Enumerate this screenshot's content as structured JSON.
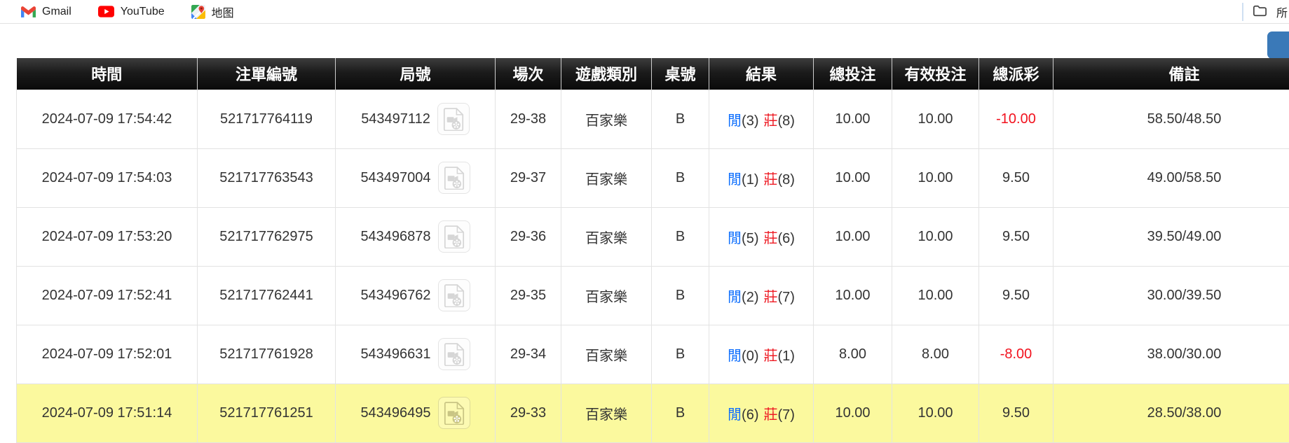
{
  "bookmarks_bar": {
    "items": [
      {
        "label": "Gmail",
        "icon": "gmail-icon"
      },
      {
        "label": "YouTube",
        "icon": "youtube-icon"
      },
      {
        "label": "地图",
        "icon": "maps-icon"
      }
    ],
    "all_bookmarks_label": "所"
  },
  "side_panel_button": {
    "color": "#3a79b8"
  },
  "table": {
    "columns": [
      "時間",
      "注單編號",
      "局號",
      "場次",
      "遊戲類別",
      "桌號",
      "結果",
      "總投注",
      "有效投注",
      "總派彩",
      "備註"
    ],
    "rows": [
      {
        "time": "2024-07-09 17:54:42",
        "bet_no": "521717764119",
        "round_no": "543497112",
        "session": "29-38",
        "game_type": "百家樂",
        "table_no": "B",
        "result": {
          "player_label": "閒",
          "player_score": "(3)",
          "banker_label": "莊",
          "banker_score": "(8)"
        },
        "total_bet": "10.00",
        "valid_bet": "10.00",
        "payout": "-10.00",
        "remark": "58.50/48.50",
        "highlighted": false
      },
      {
        "time": "2024-07-09 17:54:03",
        "bet_no": "521717763543",
        "round_no": "543497004",
        "session": "29-37",
        "game_type": "百家樂",
        "table_no": "B",
        "result": {
          "player_label": "閒",
          "player_score": "(1)",
          "banker_label": "莊",
          "banker_score": "(8)"
        },
        "total_bet": "10.00",
        "valid_bet": "10.00",
        "payout": "9.50",
        "remark": "49.00/58.50",
        "highlighted": false
      },
      {
        "time": "2024-07-09 17:53:20",
        "bet_no": "521717762975",
        "round_no": "543496878",
        "session": "29-36",
        "game_type": "百家樂",
        "table_no": "B",
        "result": {
          "player_label": "閒",
          "player_score": "(5)",
          "banker_label": "莊",
          "banker_score": "(6)"
        },
        "total_bet": "10.00",
        "valid_bet": "10.00",
        "payout": "9.50",
        "remark": "39.50/49.00",
        "highlighted": false
      },
      {
        "time": "2024-07-09 17:52:41",
        "bet_no": "521717762441",
        "round_no": "543496762",
        "session": "29-35",
        "game_type": "百家樂",
        "table_no": "B",
        "result": {
          "player_label": "閒",
          "player_score": "(2)",
          "banker_label": "莊",
          "banker_score": "(7)"
        },
        "total_bet": "10.00",
        "valid_bet": "10.00",
        "payout": "9.50",
        "remark": "30.00/39.50",
        "highlighted": false
      },
      {
        "time": "2024-07-09 17:52:01",
        "bet_no": "521717761928",
        "round_no": "543496631",
        "session": "29-34",
        "game_type": "百家樂",
        "table_no": "B",
        "result": {
          "player_label": "閒",
          "player_score": "(0)",
          "banker_label": "莊",
          "banker_score": "(1)"
        },
        "total_bet": "8.00",
        "valid_bet": "8.00",
        "payout": "-8.00",
        "remark": "38.00/30.00",
        "highlighted": false
      },
      {
        "time": "2024-07-09 17:51:14",
        "bet_no": "521717761251",
        "round_no": "543496495",
        "session": "29-33",
        "game_type": "百家樂",
        "table_no": "B",
        "result": {
          "player_label": "閒",
          "player_score": "(6)",
          "banker_label": "莊",
          "banker_score": "(7)"
        },
        "total_bet": "10.00",
        "valid_bet": "10.00",
        "payout": "9.50",
        "remark": "28.50/38.00",
        "highlighted": true
      }
    ]
  },
  "colors": {
    "bet_link_blue": "#0d6efd",
    "loss_red": "#f2121e",
    "banker_red": "#ee1c25",
    "player_blue": "#0d6efd",
    "highlight_yellow": "#fbf99e",
    "header_black": "#111111",
    "side_button_blue": "#3a79b8"
  }
}
